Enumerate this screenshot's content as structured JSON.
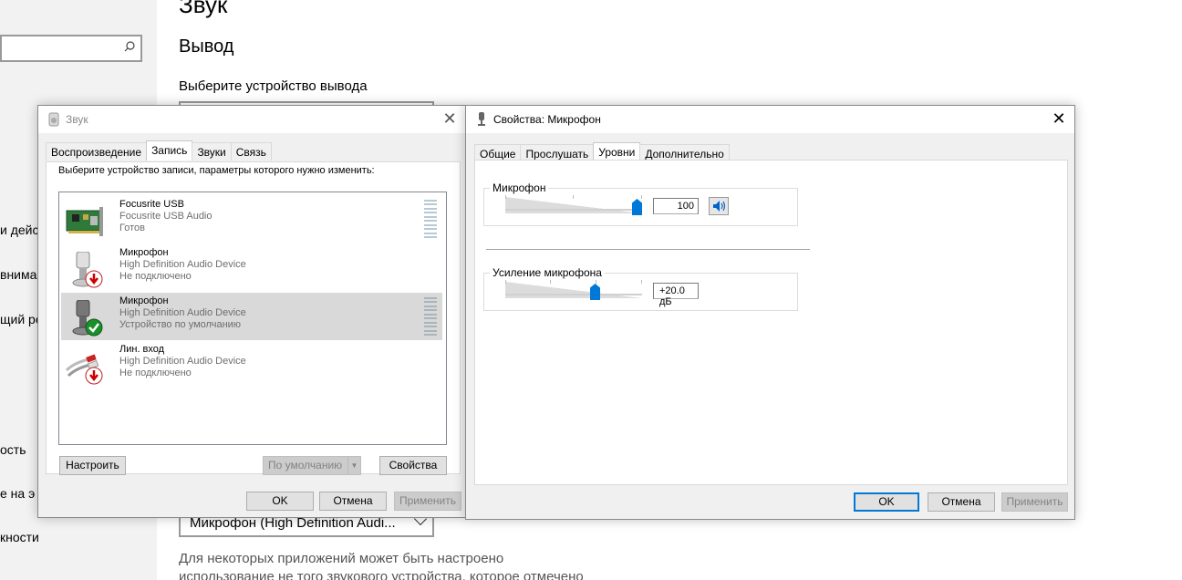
{
  "settings_bg": {
    "page_heading": "Звук",
    "section_heading": "Вывод",
    "output_label": "Выберите устройство вывода",
    "nav_fragments": [
      "и дейст",
      "внимани",
      "щий ре",
      "ость",
      "е на э",
      "кности"
    ],
    "input_device_value": "Микрофон (High Definition Audi...",
    "note_line1": "Для некоторых приложений может быть настроено",
    "note_line2": "использование не того звукового устройства, которое отмечено"
  },
  "sound_dialog": {
    "title": "Звук",
    "tabs": [
      {
        "label": "Воспроизведение",
        "active": false
      },
      {
        "label": "Запись",
        "active": true
      },
      {
        "label": "Звуки",
        "active": false
      },
      {
        "label": "Связь",
        "active": false
      }
    ],
    "instruction": "Выберите устройство записи, параметры которого нужно изменить:",
    "devices": [
      {
        "name": "Focusrite USB",
        "description": "Focusrite USB Audio",
        "status": "Готов",
        "icon": "sound-card-icon",
        "selected": false
      },
      {
        "name": "Микрофон",
        "description": "High Definition Audio Device",
        "status": "Не подключено",
        "icon": "microphone-disconnected-icon",
        "selected": false
      },
      {
        "name": "Микрофон",
        "description": "High Definition Audio Device",
        "status": "Устройство по умолчанию",
        "icon": "microphone-default-icon",
        "selected": true
      },
      {
        "name": "Лин. вход",
        "description": "High Definition Audio Device",
        "status": "Не подключено",
        "icon": "line-in-disconnected-icon",
        "selected": false
      }
    ],
    "buttons": {
      "configure": "Настроить",
      "set_default": "По умолчанию",
      "properties": "Свойства",
      "ok": "OK",
      "cancel": "Отмена",
      "apply": "Применить"
    }
  },
  "props_dialog": {
    "title": "Свойства: Микрофон",
    "tabs": [
      {
        "label": "Общие",
        "active": false
      },
      {
        "label": "Прослушать",
        "active": false
      },
      {
        "label": "Уровни",
        "active": true
      },
      {
        "label": "Дополнительно",
        "active": false
      }
    ],
    "microphone": {
      "label": "Микрофон",
      "value": "100",
      "level_fraction": 1.0
    },
    "boost": {
      "label": "Усиление микрофона",
      "value": "+20.0 дБ",
      "level_fraction": 0.667
    },
    "buttons": {
      "ok": "OK",
      "cancel": "Отмена",
      "apply": "Применить"
    }
  }
}
